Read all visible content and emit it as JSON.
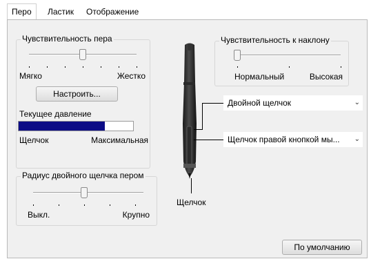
{
  "tabs": [
    {
      "label": "Перо",
      "active": true
    },
    {
      "label": "Ластик",
      "active": false
    },
    {
      "label": "Отображение",
      "active": false
    }
  ],
  "pressure": {
    "title": "Чувствительность пера",
    "min_label": "Мягко",
    "max_label": "Жестко",
    "level": 0.5,
    "customize_button": "Настроить...",
    "current_title": "Текущее давление",
    "current_fill": 0.75,
    "click_label": "Щелчок",
    "max_pressure_label": "Максимальная"
  },
  "double_click": {
    "title": "Радиус двойного щелчка пером",
    "min_label": "Выкл.",
    "max_label": "Крупно",
    "level": 0.5
  },
  "tilt": {
    "title": "Чувствительность к наклону",
    "min_label": "Нормальный",
    "max_label": "Высокая",
    "level": 0.0
  },
  "pen": {
    "upper_button": "Двойной щелчок",
    "lower_button": "Щелчок правой кнопкой мы...",
    "tip_label": "Щелчок"
  },
  "default_button": "По умолчанию",
  "colors": {
    "accent": "#1a73c9",
    "pressure_bar": "#0c0c86"
  }
}
